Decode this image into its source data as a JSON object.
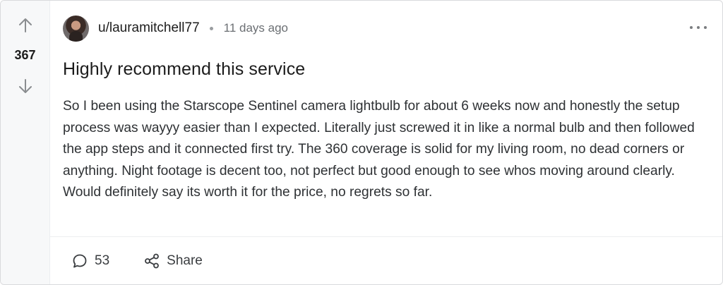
{
  "post": {
    "votes": "367",
    "author": "u/lauramitchell77",
    "time_ago": "11 days ago",
    "title": "Highly recommend this service",
    "body": "So I been using the Starscope Sentinel camera lightbulb for about 6 weeks now and honestly the setup process was wayyy easier than I expected. Literally just screwed it in like a normal bulb and then followed the app steps and it connected first try. The 360 coverage is solid for my living room, no dead corners or anything. Night footage is decent too, not perfect but good enough to see whos moving around clearly. Would definitely say its worth it for the price, no regrets so far."
  },
  "actions": {
    "comments_count": "53",
    "share_label": "Share"
  },
  "icons": {
    "upvote": "arrow-up-icon",
    "downvote": "arrow-down-icon",
    "comment": "comment-bubble-icon",
    "share": "share-icon",
    "more": "more-horizontal-icon"
  }
}
